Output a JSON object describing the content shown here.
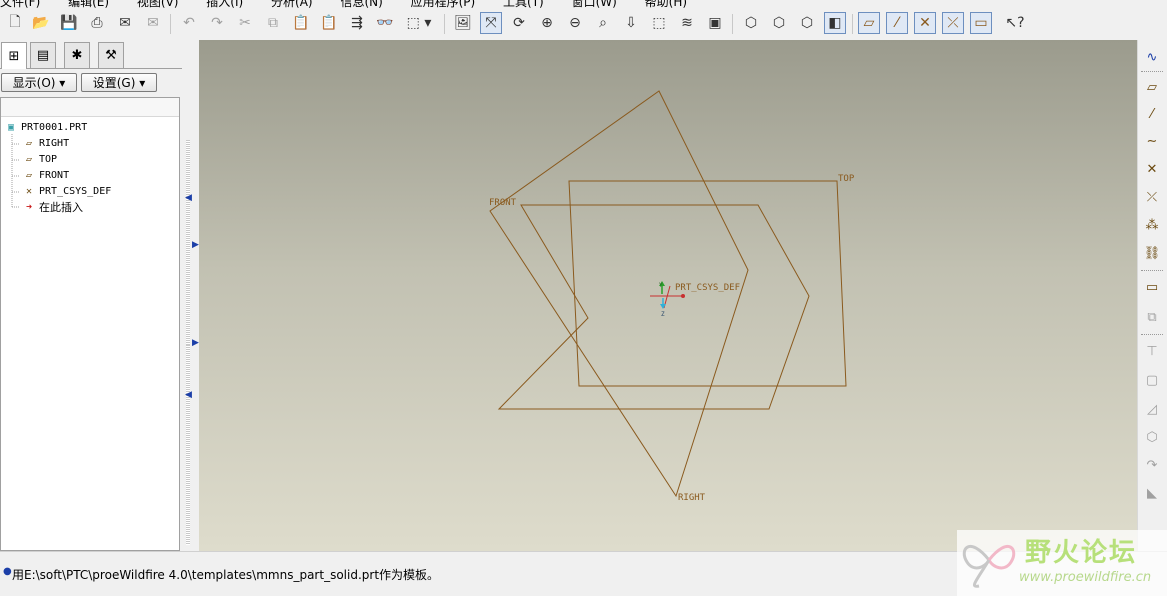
{
  "menu": {
    "items": [
      "文件(F)",
      "编辑(E)",
      "视图(V)",
      "插入(I)",
      "分析(A)",
      "信息(N)",
      "应用程序(P)",
      "工具(T)",
      "窗口(W)",
      "帮助(H)"
    ]
  },
  "toolbar": {
    "icons": [
      "new-file-icon",
      "open-folder-icon",
      "save-icon",
      "print-icon",
      "send-mail-icon",
      "mail-disabled-icon",
      "undo-icon",
      "redo-icon",
      "cut-icon",
      "copy-icon",
      "paste-icon",
      "paste-special-icon",
      "regenerate-icon",
      "find-icon",
      "select-box-icon",
      "repaint-icon",
      "spin-center-icon",
      "orient-mode-icon",
      "zoom-in-icon",
      "zoom-out-icon",
      "refit-icon",
      "reorient-icon",
      "saved-views-icon",
      "layers-icon",
      "view-manager-icon",
      "wireframe-icon",
      "hidden-line-icon",
      "no-hidden-icon",
      "shading-icon",
      "datum-planes-icon",
      "datum-axes-icon",
      "datum-points-icon",
      "csys-icon",
      "annotation-display-icon",
      "whats-this-icon"
    ]
  },
  "left_panel": {
    "tabs": [
      "model-tree-tab",
      "layer-tab",
      "favorites-tab",
      "connections-tab"
    ],
    "show_button": "显示(O) ▾",
    "settings_button": "设置(G) ▾",
    "tree": {
      "root": "PRT0001.PRT",
      "items": [
        "RIGHT",
        "TOP",
        "FRONT",
        "PRT_CSYS_DEF"
      ],
      "insert_here": "在此插入"
    }
  },
  "viewport": {
    "labels": {
      "top": "TOP",
      "front": "FRONT",
      "right": "RIGHT",
      "csys": "PRT_CSYS_DEF",
      "csys_x": "X",
      "csys_y": "Y",
      "csys_z": "Z"
    }
  },
  "right_toolbar": {
    "icons": [
      "sketch-tool-icon",
      "datum-plane-icon",
      "datum-axis-icon",
      "datum-curve-icon",
      "datum-point-icon",
      "datum-point-offset-icon",
      "datum-point-field-icon",
      "csys-tool-icon",
      "analysis-feature-icon",
      "extrude-icon",
      "revolve-icon",
      "variable-section-icon",
      "blend-icon",
      "hole-icon",
      "shell-icon",
      "rib-icon",
      "draft-icon",
      "round-icon"
    ]
  },
  "status": {
    "message": "用E:\\soft\\PTC\\proeWildfire 4.0\\templates\\mmns_part_solid.prt作为模板。"
  },
  "watermark": {
    "title": "野火论坛",
    "url": "www.proewildfire.cn"
  },
  "colors": {
    "datum": "#8a5a1e",
    "viewport_top": "#9b9b8d",
    "viewport_bottom": "#dedccc",
    "accent": "#1c3fa8"
  }
}
